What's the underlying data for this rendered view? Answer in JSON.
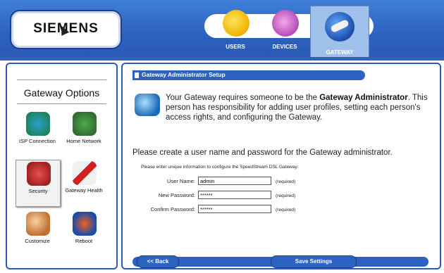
{
  "header": {
    "logo": "SIEMENS",
    "tabs": [
      {
        "label": "USERS",
        "icon": "users-icon"
      },
      {
        "label": "DEVICES",
        "icon": "devices-icon"
      },
      {
        "label": "GATEWAY",
        "icon": "gateway-icon",
        "selected": true
      }
    ]
  },
  "sidebar": {
    "title": "Gateway Options",
    "items": [
      {
        "label": "ISP Connection",
        "icon": "isp-connection-icon"
      },
      {
        "label": "Home Network",
        "icon": "home-network-icon"
      },
      {
        "label": "Security",
        "icon": "security-icon",
        "selected": true
      },
      {
        "label": "Gateway Health",
        "icon": "gateway-health-icon"
      },
      {
        "label": "Customize",
        "icon": "customize-icon"
      },
      {
        "label": "Reboot",
        "icon": "reboot-icon"
      }
    ]
  },
  "main": {
    "title": "Gateway Administrator Setup",
    "intro_pre": "Your Gateway requires someone to be the ",
    "intro_bold": "Gateway Administrator",
    "intro_post": ". This person has responsibility for adding user profiles, setting each person's access rights, and configuring the Gateway.",
    "prompt": "Please create a user name and password for the Gateway administrator.",
    "subprompt": "Please enter unique information to configure the SpeedStream DSL Gateway:",
    "fields": [
      {
        "label": "User Name:",
        "value": "admin",
        "required": "(required)"
      },
      {
        "label": "New Password:",
        "value": "******",
        "required": "(required)"
      },
      {
        "label": "Confirm Password:",
        "value": "******",
        "required": "(required)"
      }
    ],
    "back_label": "<< Back",
    "save_label": "Save Settings"
  },
  "colors": {
    "accent": "#2d62c0",
    "header": "#3f7fd8"
  }
}
